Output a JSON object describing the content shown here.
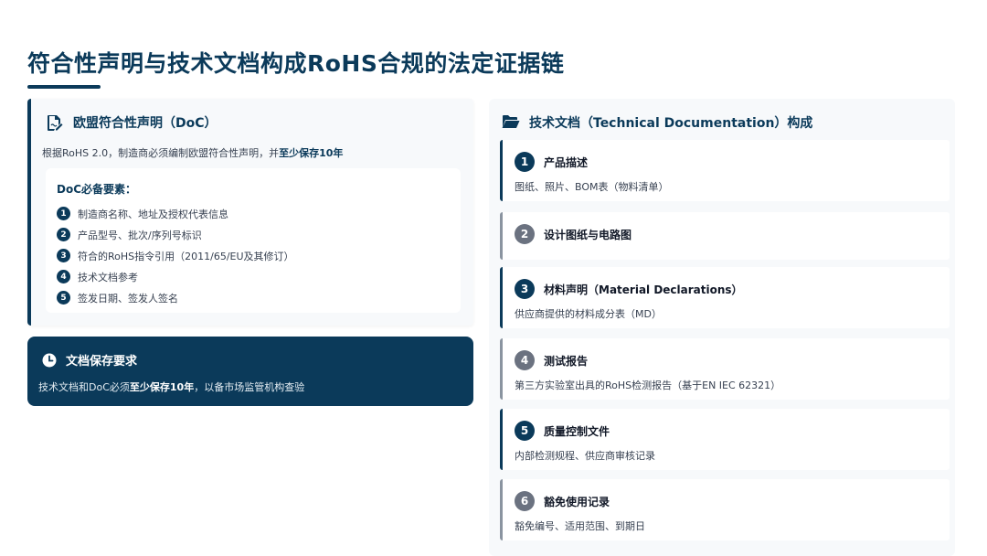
{
  "page": {
    "title": "符合性声明与技术文档构成RoHS合规的法定证据链"
  },
  "doc_card": {
    "icon": "file-signature-icon",
    "title": "欧盟符合性声明（DoC）",
    "desc_prefix": "根据RoHS 2.0，制造商必须编制欧盟符合性声明，并",
    "desc_bold": "至少保存10年",
    "requirements_title": "DoC必备要素：",
    "requirements": [
      {
        "num": "1",
        "text": "制造商名称、地址及授权代表信息"
      },
      {
        "num": "2",
        "text": "产品型号、批次/序列号标识"
      },
      {
        "num": "3",
        "text": "符合的RoHS指令引用（2011/65/EU及其修订）"
      },
      {
        "num": "4",
        "text": "技术文档参考"
      },
      {
        "num": "5",
        "text": "签发日期、签发人签名"
      }
    ]
  },
  "storage_card": {
    "icon": "clock-icon",
    "title": "文档保存要求",
    "text_prefix": "技术文档和DoC必须",
    "text_bold": "至少保存10年",
    "text_suffix": "，以备市场监管机构查验"
  },
  "tech_panel": {
    "icon": "folder-open-icon",
    "title": "技术文档（Technical Documentation）构成",
    "items": [
      {
        "num": "1",
        "title": "产品描述",
        "desc": "图纸、照片、BOM表（物料清单）",
        "style": "dark"
      },
      {
        "num": "2",
        "title": "设计图纸与电路图",
        "desc": "",
        "style": "gray"
      },
      {
        "num": "3",
        "title": "材料声明（Material Declarations）",
        "desc": "供应商提供的材料成分表（MD）",
        "style": "dark"
      },
      {
        "num": "4",
        "title": "测试报告",
        "desc": "第三方实验室出具的RoHS检测报告（基于EN IEC 62321）",
        "style": "gray"
      },
      {
        "num": "5",
        "title": "质量控制文件",
        "desc": "内部检测规程、供应商审核记录",
        "style": "dark"
      },
      {
        "num": "6",
        "title": "豁免使用记录",
        "desc": "豁免编号、适用范围、到期日",
        "style": "gray"
      }
    ]
  },
  "colors": {
    "primary": "#0b3a5a",
    "gray_accent": "#6b7280",
    "panel_bg": "#f7f9fb"
  }
}
